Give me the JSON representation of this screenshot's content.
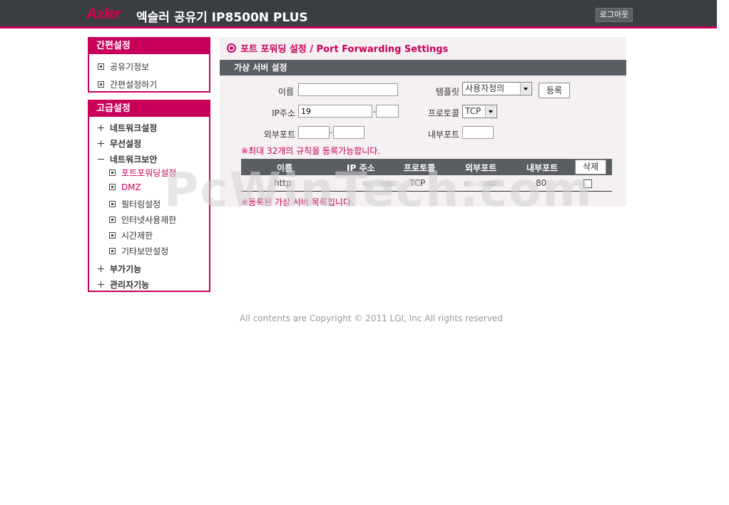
{
  "header": {
    "logo": "Axler",
    "title": "엑슬러 공유기 IP8500N PLUS",
    "logout_label": "로그아웃"
  },
  "sidebar": {
    "basic": {
      "heading": "간편설정",
      "items": [
        "공유기정보",
        "간편설정하기"
      ]
    },
    "advanced": {
      "heading": "고급설정",
      "groups": [
        {
          "label": "네트워크설정",
          "expanded": false
        },
        {
          "label": "무선설정",
          "expanded": false
        },
        {
          "label": "네트워크보안",
          "expanded": true,
          "children": [
            "포트포워딩설정",
            "DMZ",
            "필터링설정",
            "인터넷사용제한",
            "시간제한",
            "기타보안설정"
          ]
        },
        {
          "label": "부가기능",
          "expanded": false
        },
        {
          "label": "관리자기능",
          "expanded": false
        }
      ]
    }
  },
  "main": {
    "title": "포트 포워딩 설정 / Port Forwarding Settings",
    "section": "가상 서버 설정",
    "form": {
      "name_label": "이름",
      "name_value": "",
      "ip_label": "IP주소",
      "ip_value": "19",
      "ext_port_label": "외부포트",
      "template_label": "템플릿",
      "template_value": "사용자정의",
      "register_label": "등록",
      "protocol_label": "프로토콜",
      "protocol_value": "TCP",
      "int_port_label": "내부포트",
      "ip_sep": "-",
      "port_sep": "-"
    },
    "max_note": "※최대 32개의 규칙을 등록가능합니다.",
    "table": {
      "headers": [
        "이름",
        "IP 주소",
        "프로토콜",
        "외부포트",
        "내부포트"
      ],
      "delete_label": "삭제",
      "rows": [
        {
          "name": "http",
          "ip": "",
          "protocol": "TCP",
          "ext_port": "",
          "int_port": "80"
        }
      ]
    },
    "list_note": "※등록된 가상 서버 목록입니다."
  },
  "watermark": "PcWinTech.com",
  "footer": "All contents are Copyright © 2011 LGI, Inc All rights reserved",
  "colors": {
    "accent": "#c8005a",
    "header_bg": "#3a3d42",
    "bar_bg": "#5a5d62"
  }
}
